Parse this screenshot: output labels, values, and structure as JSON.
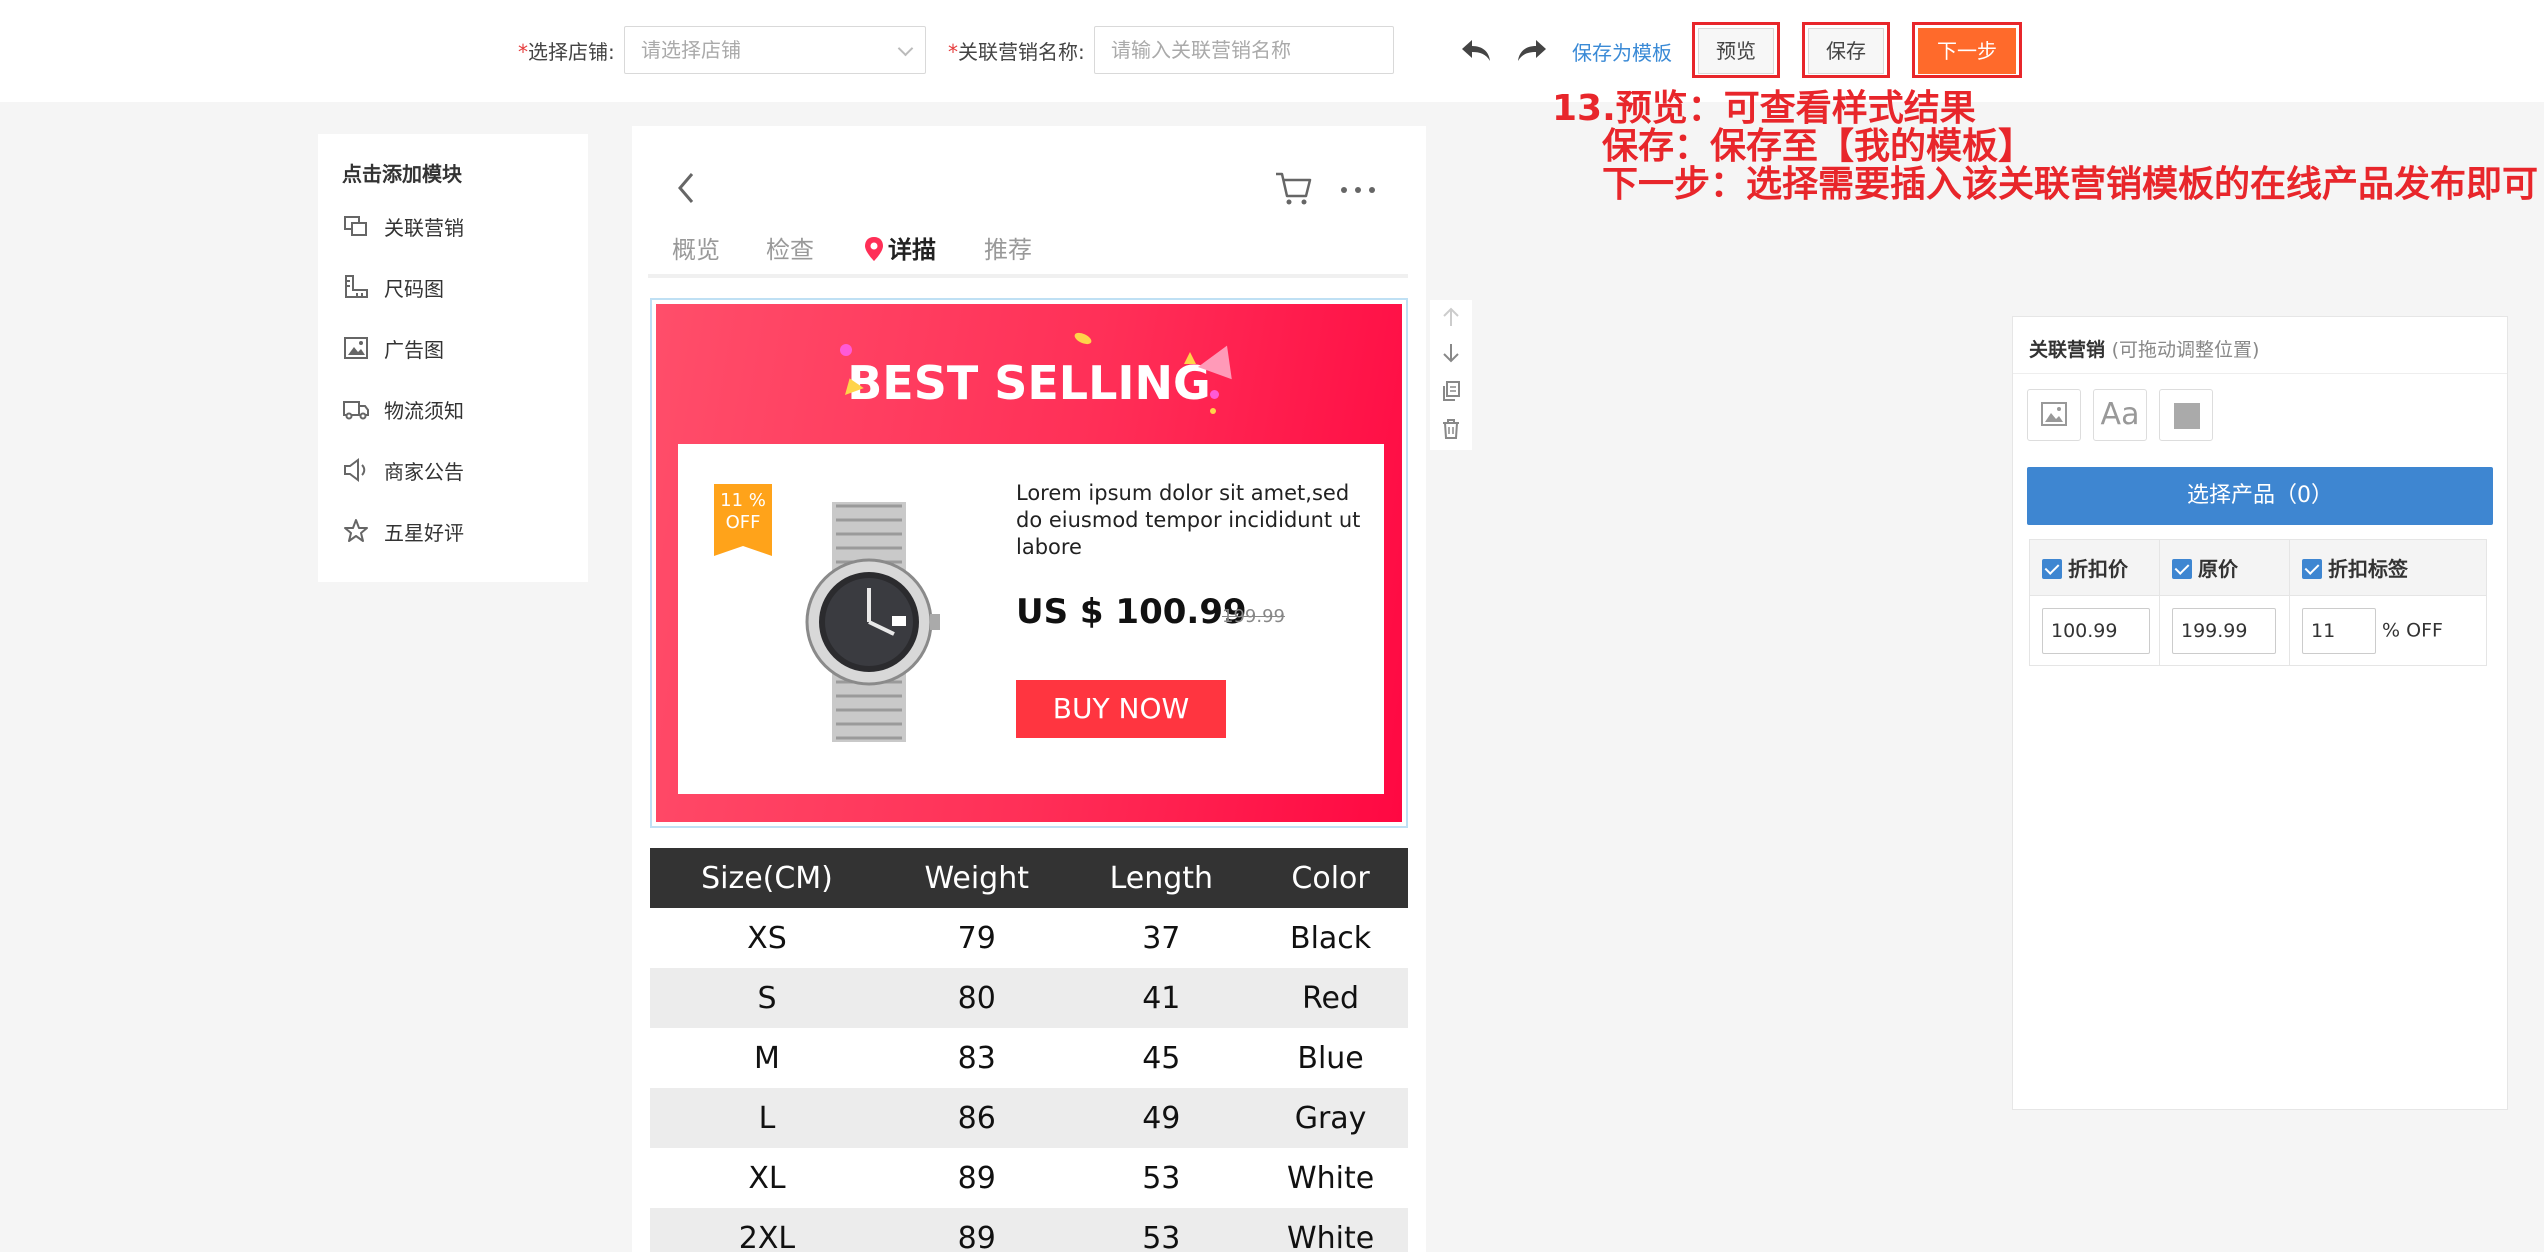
{
  "topbar": {
    "store_label": "选择店铺",
    "store_placeholder": "请选择店铺",
    "marketing_name_label": "关联营销名称",
    "marketing_name_placeholder": "请输入关联营销名称",
    "required_mark": "*",
    "colon": ":",
    "save_template_link": "保存为模板",
    "preview_button": "预览",
    "save_button": "保存",
    "next_button": "下一步"
  },
  "annotation": {
    "line1": "13.预览：可查看样式结果",
    "line2": "保存：保存至【我的模板】",
    "line3": "下一步：选择需要插入该关联营销模板的在线产品发布即可"
  },
  "sidebar": {
    "title": "点击添加模块",
    "items": [
      {
        "label": "关联营销",
        "icon": "related-marketing-icon"
      },
      {
        "label": "尺码图",
        "icon": "ruler-icon"
      },
      {
        "label": "广告图",
        "icon": "image-icon"
      },
      {
        "label": "物流须知",
        "icon": "truck-icon"
      },
      {
        "label": "商家公告",
        "icon": "megaphone-icon"
      },
      {
        "label": "五星好评",
        "icon": "star-icon"
      }
    ]
  },
  "preview": {
    "tabs": [
      "概览",
      "检查",
      "详描",
      "推荐"
    ],
    "active_tab": "详描",
    "banner": {
      "headline": "BEST SELLING",
      "badge_line1": "11 %",
      "badge_line2": "OFF",
      "description": "Lorem ipsum dolor sit amet,sed do eiusmod tempor incididunt ut labore",
      "price": "US $ 100.99",
      "original_price": "199.99",
      "buy_button": "BUY NOW"
    },
    "size_table": {
      "headers": [
        "Size(CM)",
        "Weight",
        "Length",
        "Color"
      ],
      "rows": [
        [
          "XS",
          "79",
          "37",
          "Black"
        ],
        [
          "S",
          "80",
          "41",
          "Red"
        ],
        [
          "M",
          "83",
          "45",
          "Blue"
        ],
        [
          "L",
          "86",
          "49",
          "Gray"
        ],
        [
          "XL",
          "89",
          "53",
          "White"
        ],
        [
          "2XL",
          "89",
          "53",
          "White"
        ]
      ]
    }
  },
  "panel": {
    "title": "关联营销",
    "title_hint": "(可拖动调整位置)",
    "font_tool_label": "Aa",
    "choose_button": "选择产品（0）",
    "columns": [
      "折扣价",
      "原价",
      "折扣标签"
    ],
    "discount_price": "100.99",
    "original_price": "199.99",
    "discount_tag": "11",
    "discount_suffix": "% OFF"
  },
  "colors": {
    "accent_blue": "#3e86d1",
    "next_orange": "#ff6a2b",
    "annotation_red": "#e8262b",
    "banner_red": "#ff2f57"
  }
}
